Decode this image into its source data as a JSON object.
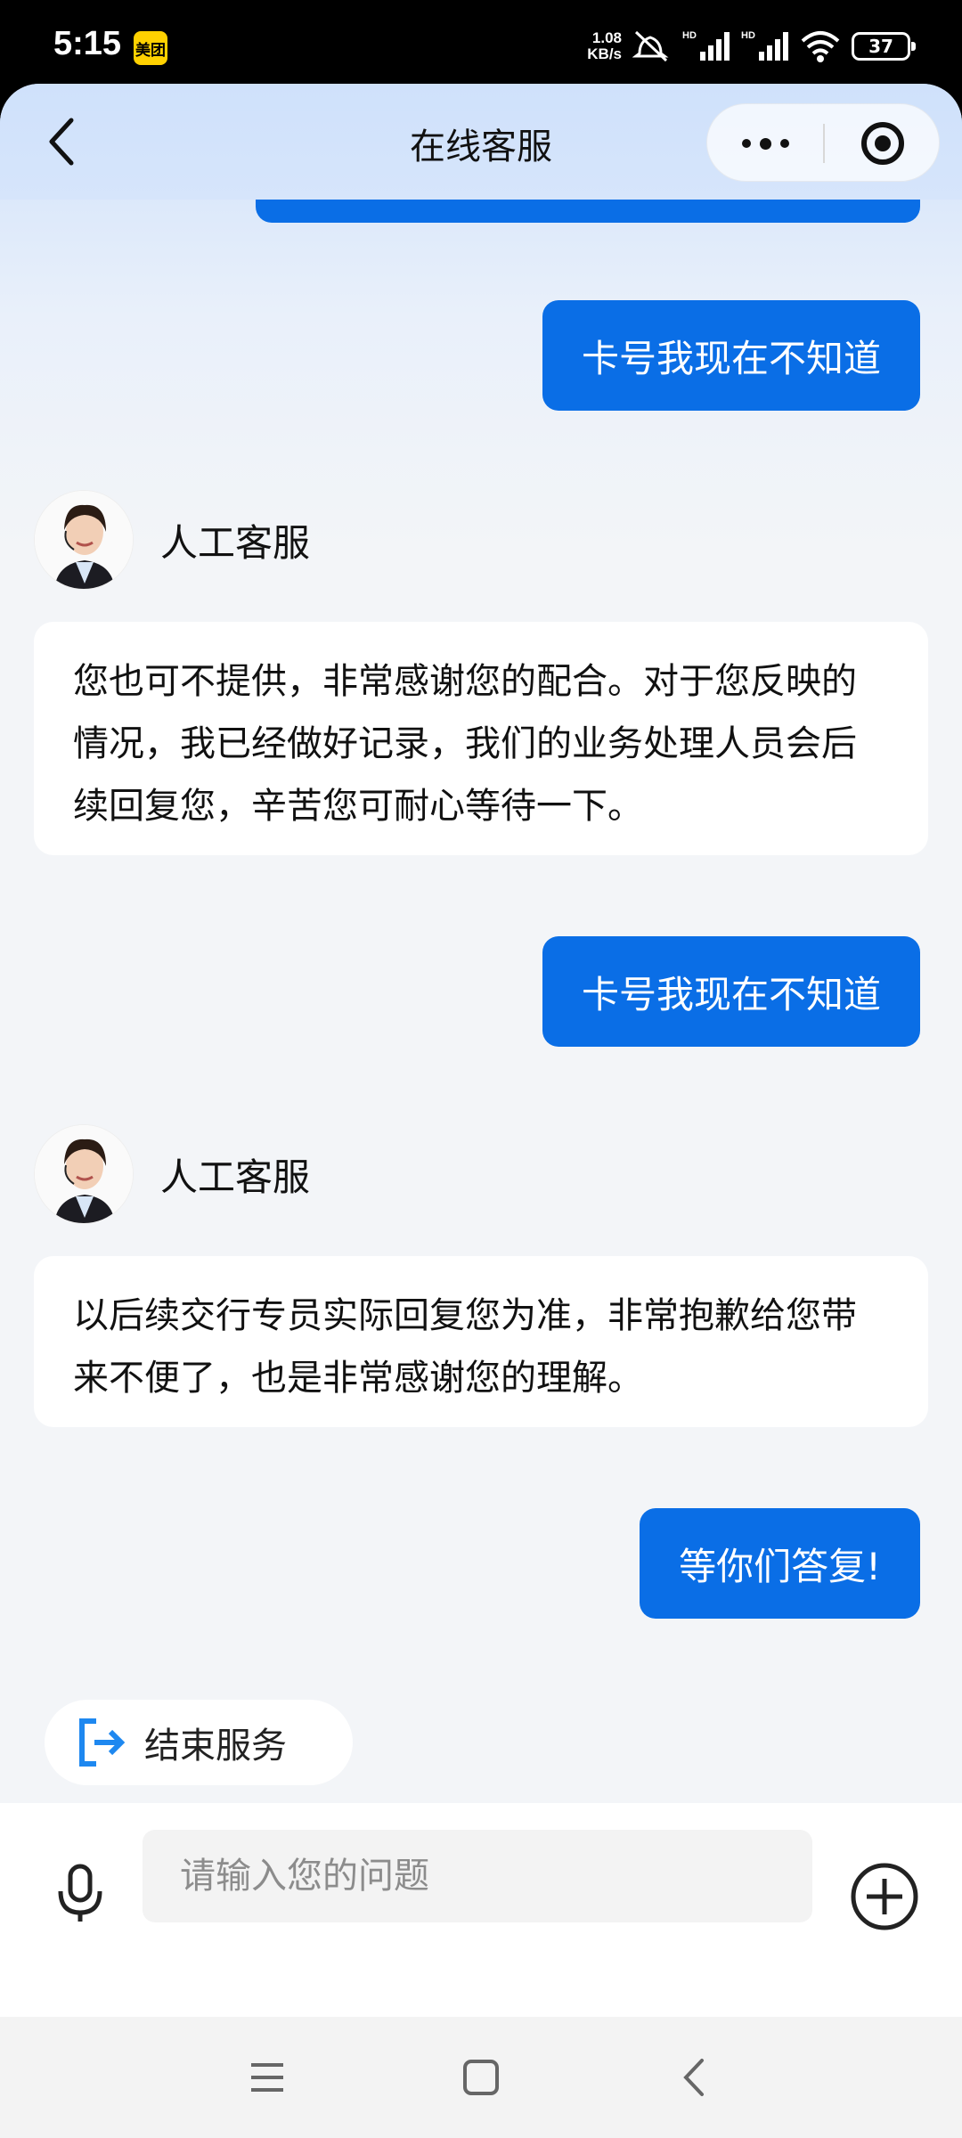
{
  "status_bar": {
    "time": "5:15",
    "notification_badge": "美团",
    "net_speed_value": "1.08",
    "net_speed_unit": "KB/s",
    "battery": "37",
    "icons": [
      "mute-icon",
      "signal-hd-icon",
      "signal-hd-icon",
      "wifi-icon",
      "battery-icon"
    ]
  },
  "header": {
    "title": "在线客服",
    "icons": [
      "back-icon",
      "more-icon",
      "close-mini-program-icon"
    ]
  },
  "messages": [
    {
      "side": "user",
      "text": "卡号我现在不知道"
    },
    {
      "side": "agent",
      "name": "人工客服",
      "text": "您也可不提供，非常感谢您的配合。对于您反映的情况，我已经做好记录，我们的业务处理人员会后续回复您，辛苦您可耐心等待一下。"
    },
    {
      "side": "user",
      "text": "卡号我现在不知道"
    },
    {
      "side": "agent",
      "name": "人工客服",
      "text": "以后续交行专员实际回复您为准，非常抱歉给您带来不便了，也是非常感谢您的理解。"
    },
    {
      "side": "user",
      "text": "等你们答复!"
    }
  ],
  "end_service": {
    "label": "结束服务",
    "icon": "exit-icon"
  },
  "input": {
    "placeholder": "请输入您的问题",
    "value": ""
  },
  "colors": {
    "accent": "#0a6ee6",
    "header_gradient_top": "#cfe1fb",
    "chat_background": "#f3f5f8"
  }
}
